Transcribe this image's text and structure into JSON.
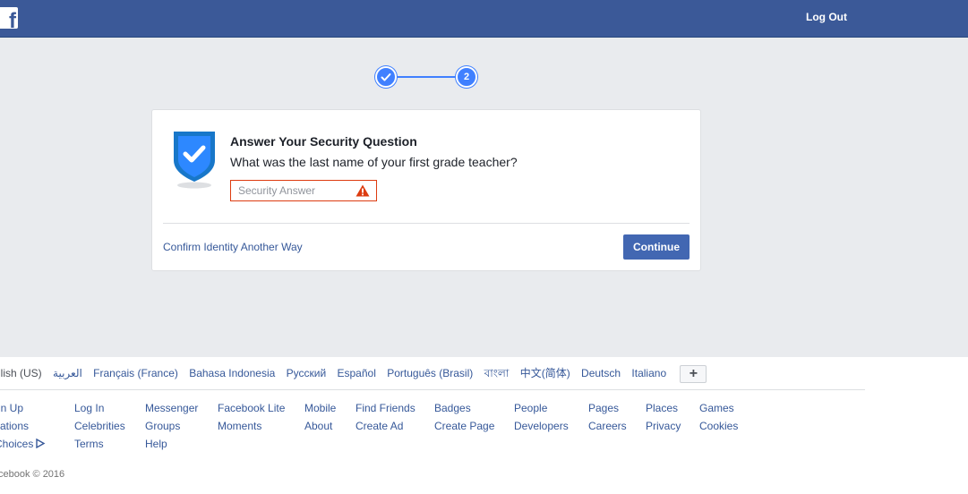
{
  "header": {
    "logo": "f",
    "logout_label": "Log Out"
  },
  "stepper": {
    "step1_icon": "check-icon",
    "step2_label": "2"
  },
  "card": {
    "title": "Answer Your Security Question",
    "question": "What was the last name of your first grade teacher?",
    "answer_placeholder": "Security Answer",
    "answer_value": "",
    "alt_link": "Confirm Identity Another Way",
    "continue_label": "Continue"
  },
  "footer": {
    "languages": [
      "glish (US)",
      "العربية",
      "Français (France)",
      "Bahasa Indonesia",
      "Русский",
      "Español",
      "Português (Brasil)",
      "বাংলা",
      "中文(简体)",
      "Deutsch",
      "Italiano"
    ],
    "add_language": "+",
    "link_columns": [
      [
        "gn Up",
        "cations",
        " Choices"
      ],
      [
        "Log In",
        "Celebrities",
        "Terms"
      ],
      [
        "Messenger",
        "Groups",
        "Help"
      ],
      [
        "Facebook Lite",
        "Moments"
      ],
      [
        "Mobile",
        "About"
      ],
      [
        "Find Friends",
        "Create Ad"
      ],
      [
        "Badges",
        "Create Page"
      ],
      [
        "People",
        "Developers"
      ],
      [
        "Pages",
        "Careers"
      ],
      [
        "Places",
        "Privacy"
      ],
      [
        "Games",
        "Cookies"
      ]
    ],
    "copyright": "cebook © 2016"
  },
  "colors": {
    "brand": "#3b5998",
    "button": "#4267b2",
    "step": "#4080ff",
    "error": "#dd3c10",
    "link": "#365899"
  }
}
